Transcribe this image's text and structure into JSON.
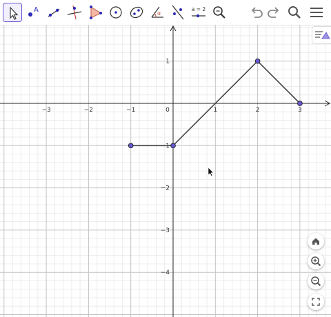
{
  "toolbar": {
    "tools": [
      {
        "id": "move",
        "name": "move-tool",
        "active": true
      },
      {
        "id": "point",
        "name": "point-tool",
        "label": "A"
      },
      {
        "id": "line",
        "name": "line-tool"
      },
      {
        "id": "perpendicular",
        "name": "perpendicular-line-tool"
      },
      {
        "id": "polygon",
        "name": "polygon-tool"
      },
      {
        "id": "circle",
        "name": "circle-tool"
      },
      {
        "id": "conic",
        "name": "conic-tool"
      },
      {
        "id": "angle",
        "name": "angle-tool",
        "label": "α"
      },
      {
        "id": "reflect",
        "name": "reflect-tool"
      },
      {
        "id": "slider",
        "name": "slider-tool",
        "label": "a = 2"
      },
      {
        "id": "zoom",
        "name": "zoom-tool"
      }
    ],
    "undo_icon": "undo-icon",
    "redo_icon": "redo-icon",
    "search_icon": "search-icon",
    "menu_icon": "menu-icon"
  },
  "graph": {
    "x_ticks": [
      "−3",
      "−2",
      "−1",
      "0",
      "1",
      "2",
      "3"
    ],
    "y_ticks": [
      "1",
      "−1",
      "−2",
      "−3",
      "−4"
    ],
    "points": [
      {
        "x": -1,
        "y": -1
      },
      {
        "x": 0,
        "y": -1
      },
      {
        "x": 2,
        "y": 1
      },
      {
        "x": 3,
        "y": 0
      }
    ],
    "segments": [
      [
        0,
        1
      ],
      [
        1,
        2
      ],
      [
        2,
        3
      ]
    ],
    "colors": {
      "point_fill": "#6557d2",
      "segment": "#444444",
      "major_grid": "#c4c4c4",
      "minor_grid": "#ececec",
      "axis": "#252525"
    }
  },
  "side_buttons": [
    "home-icon",
    "zoom-in-icon",
    "zoom-out-icon",
    "fullscreen-icon"
  ]
}
